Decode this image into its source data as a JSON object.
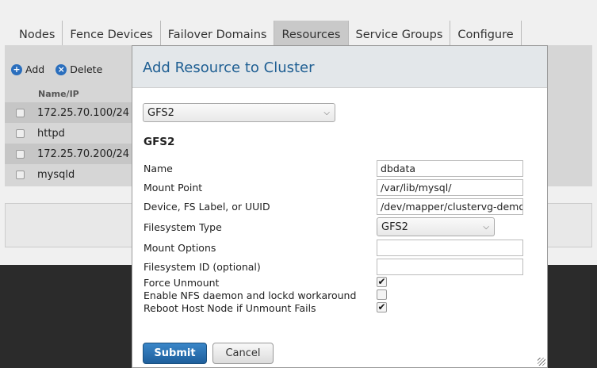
{
  "tabs": [
    {
      "label": "Nodes"
    },
    {
      "label": "Fence Devices"
    },
    {
      "label": "Failover Domains"
    },
    {
      "label": "Resources"
    },
    {
      "label": "Service Groups"
    },
    {
      "label": "Configure"
    }
  ],
  "toolbar": {
    "add_label": "Add",
    "delete_label": "Delete"
  },
  "resource_table": {
    "column_header": "Name/IP",
    "rows": [
      "172.25.70.100/24",
      "httpd",
      "172.25.70.200/24",
      "mysqld"
    ]
  },
  "modal": {
    "title": "Add Resource to Cluster",
    "resource_type_selected": "GFS2",
    "section_heading": "GFS2",
    "fields": {
      "name": {
        "label": "Name",
        "value": "dbdata"
      },
      "mount_point": {
        "label": "Mount Point",
        "value": "/var/lib/mysql/"
      },
      "device": {
        "label": "Device, FS Label, or UUID",
        "value": "/dev/mapper/clustervg-demo"
      },
      "fs_type": {
        "label": "Filesystem Type",
        "value": "GFS2"
      },
      "mount_options": {
        "label": "Mount Options",
        "value": ""
      },
      "fs_id": {
        "label": "Filesystem ID (optional)",
        "value": ""
      },
      "force_unmount": {
        "label": "Force Unmount",
        "checked": "✔"
      },
      "nfs_workaround": {
        "label": "Enable NFS daemon and lockd workaround",
        "checked": ""
      },
      "reboot_host": {
        "label": "Reboot Host Node if Unmount Fails",
        "checked": "✔"
      }
    },
    "submit_label": "Submit",
    "cancel_label": "Cancel"
  }
}
